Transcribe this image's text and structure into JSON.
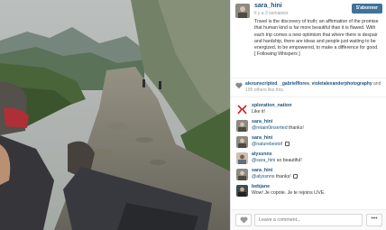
{
  "post": {
    "username": "sara_hini",
    "time_ago": "Il y a 3 semaines",
    "follow_label": "S'abonner",
    "caption": "Travel is the discovery of truth; an affirmation of the promise that human kind is far more beautiful than it is flawed. With each trip comes a new optimism that where there is despair and hardship, there are ideas and people just waiting to be energized, to be empowered, to make a difference for good. [ Following Whispers ]"
  },
  "likes": {
    "user1": "alexunscripted",
    "user2": "_gabrielflores",
    "user3": "violetalexanderphotography",
    "separator1": ",",
    "separator2": "and",
    "others_count": "195",
    "others_text": "others like this."
  },
  "comments": [
    {
      "user": "xploration_nation",
      "mention": "",
      "text": "Like it!",
      "emoji": false
    },
    {
      "user": "sara_hini",
      "mention": "@retain0inserted",
      "text": "thanks!",
      "emoji": false
    },
    {
      "user": "sara_hini",
      "mention": "@naturebestof",
      "text": "",
      "emoji": true
    },
    {
      "user": "alyssnnx",
      "mention": "@sara_hini",
      "text": "so beautiful!",
      "emoji": false
    },
    {
      "user": "sara_hini",
      "mention": "@alyssnnx",
      "text": "thanks!",
      "emoji": true
    },
    {
      "user": "bebjane",
      "mention": "",
      "text": "Wow! Je copote. Je te rejoins LIVE.",
      "emoji": false
    }
  ],
  "footer": {
    "comment_placeholder": "Leave a comment...",
    "more_label": "•••"
  },
  "icons": {
    "heart": "heart-icon",
    "more": "more-options-icon",
    "chat": "chat-icon"
  },
  "colors": {
    "link": "#1c5380",
    "follow_button": "#3f729b"
  }
}
